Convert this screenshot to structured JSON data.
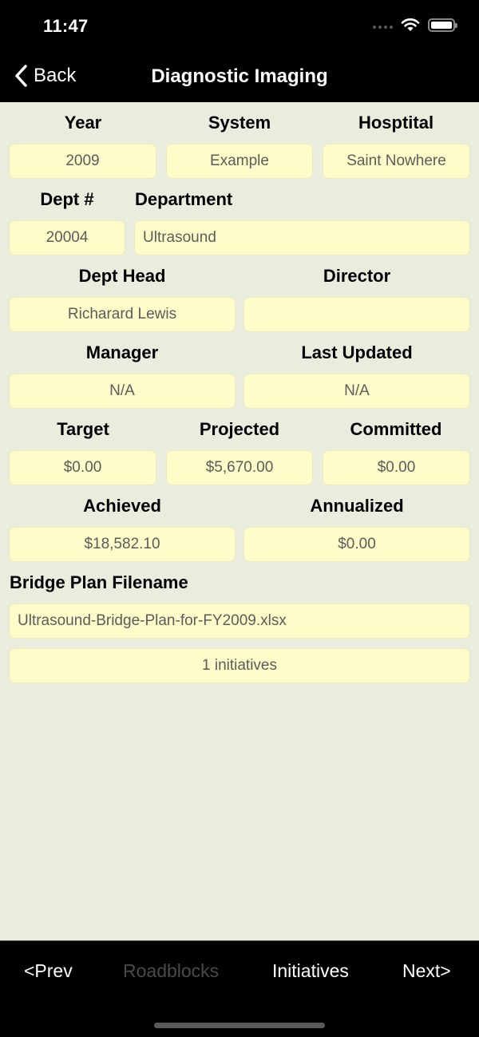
{
  "status_bar": {
    "time": "11:47",
    "icons": [
      "signal-dots-icon",
      "wifi-icon",
      "battery-icon"
    ]
  },
  "nav": {
    "back_label": "Back",
    "title": "Diagnostic Imaging"
  },
  "form": {
    "year": {
      "label": "Year",
      "value": "2009"
    },
    "system": {
      "label": "System",
      "value": "Example"
    },
    "hospital": {
      "label": "Hosptital",
      "value": "Saint Nowhere"
    },
    "dept_num": {
      "label": "Dept #",
      "value": "20004"
    },
    "department": {
      "label": "Department",
      "value": "Ultrasound"
    },
    "dept_head": {
      "label": "Dept Head",
      "value": "Richarard Lewis"
    },
    "director": {
      "label": "Director",
      "value": ""
    },
    "manager": {
      "label": "Manager",
      "value": "N/A"
    },
    "last_updated": {
      "label": "Last Updated",
      "value": "N/A"
    },
    "target": {
      "label": "Target",
      "value": "$0.00"
    },
    "projected": {
      "label": "Projected",
      "value": "$5,670.00"
    },
    "committed": {
      "label": "Committed",
      "value": "$0.00"
    },
    "achieved": {
      "label": "Achieved",
      "value": "$18,582.10"
    },
    "annualized": {
      "label": "Annualized",
      "value": "$0.00"
    },
    "bridge_plan": {
      "label": "Bridge Plan Filename",
      "value": "Ultrasound-Bridge-Plan-for-FY2009.xlsx"
    },
    "initiatives_summary": "1 initiatives"
  },
  "toolbar": {
    "prev": "<Prev",
    "roadblocks": "Roadblocks",
    "initiatives": "Initiatives",
    "next": "Next>"
  },
  "colors": {
    "background": "#eaeddd",
    "field_background": "#fefdc9",
    "bars": "#000000",
    "disabled_text": "#4a4a4a"
  }
}
